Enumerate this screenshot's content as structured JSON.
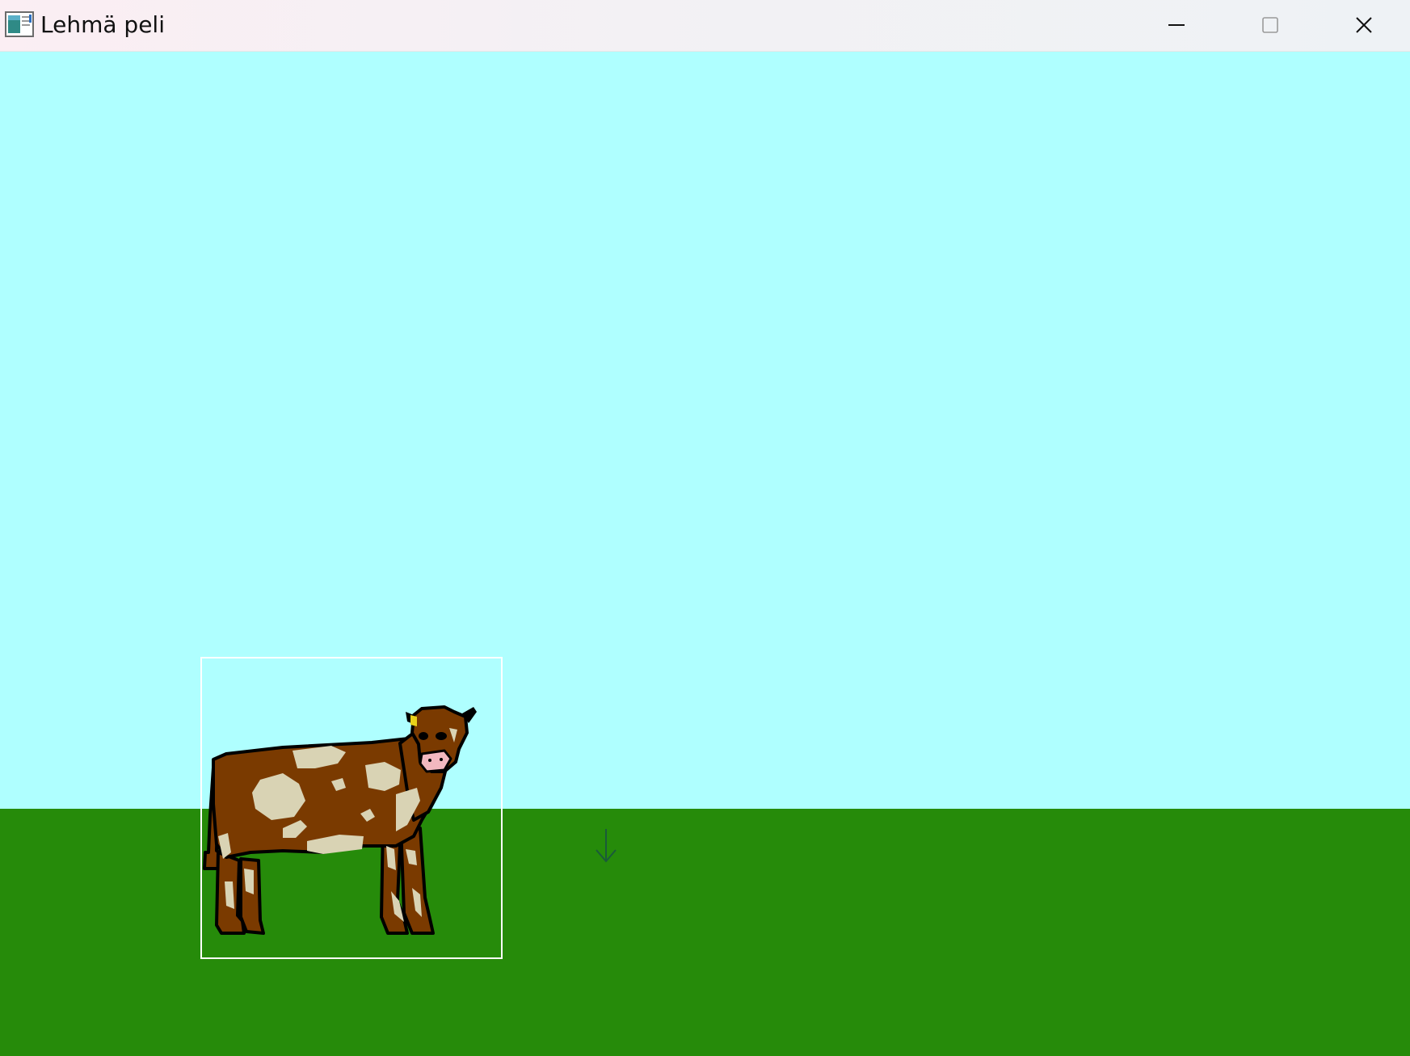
{
  "window": {
    "title": "Lehmä peli",
    "icon": "app-window-icon",
    "controls": {
      "minimize": "minimize-icon",
      "maximize": "maximize-icon",
      "close": "close-icon"
    }
  },
  "scene": {
    "sky_color": "#afffff",
    "ground_color": "#268b0a",
    "sprite": {
      "name": "cow",
      "body_color": "#7a3a00",
      "spot_color": "#d9d3b4",
      "outline_color": "#000000",
      "nose_color": "#f2b8c0",
      "selection_border_color": "#ffffff"
    },
    "cursor_icon": "down-arrow-icon"
  }
}
